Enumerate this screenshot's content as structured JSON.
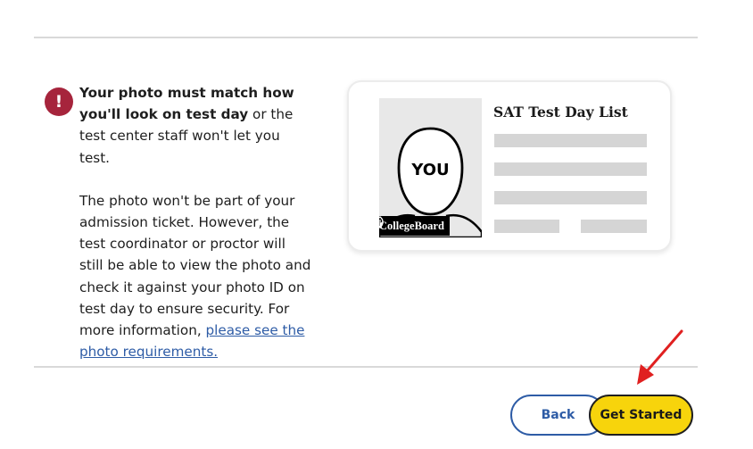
{
  "alert": {
    "icon": "exclamation-icon",
    "icon_glyph": "!",
    "icon_color": "#a6243c",
    "bold_text": "Your photo must match how you'll look on test day",
    "rest_text": " or the test center staff won't let you test.",
    "paragraph2": "The photo won't be part of your admission ticket. However, the test coordinator or proctor will still be able to view the photo and check it against your photo ID on test day to ensure security. For more information, ",
    "link_text": "please see the photo requirements."
  },
  "card": {
    "title": "SAT Test Day List",
    "photo_label": "YOU",
    "brand": "CollegeBoard",
    "brand_icon": "acorn-icon"
  },
  "buttons": {
    "back_label": "Back",
    "start_label": "Get Started"
  },
  "colors": {
    "accent_blue": "#2e5ca6",
    "primary_yellow": "#f7d40c",
    "annotation_red": "#e02020"
  }
}
